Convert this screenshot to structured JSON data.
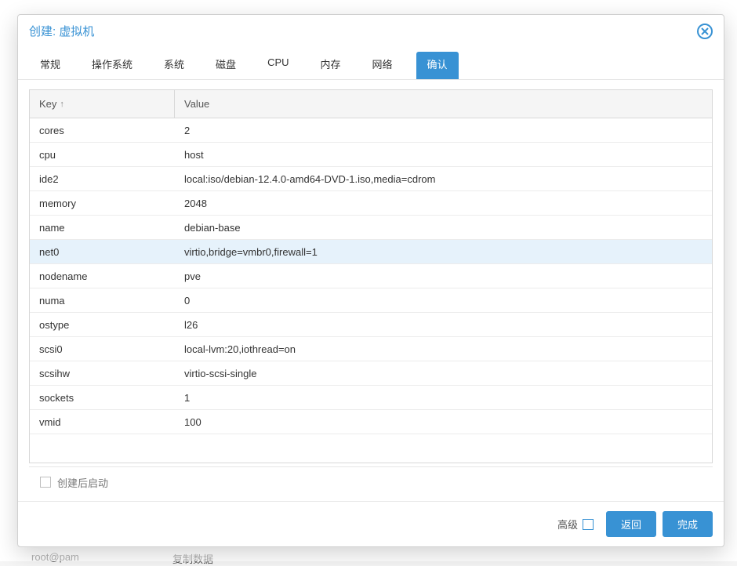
{
  "backdrop": {
    "text1": "root@pam",
    "text2": "复制数据"
  },
  "dialog": {
    "title": "创建: 虚拟机"
  },
  "tabs": [
    {
      "label": "常规"
    },
    {
      "label": "操作系统"
    },
    {
      "label": "系统"
    },
    {
      "label": "磁盘"
    },
    {
      "label": "CPU"
    },
    {
      "label": "内存"
    },
    {
      "label": "网络"
    },
    {
      "label": "确认",
      "active": true
    }
  ],
  "grid": {
    "keyHeader": "Key",
    "valueHeader": "Value",
    "sortArrow": "↑",
    "rows": [
      {
        "key": "cores",
        "value": "2"
      },
      {
        "key": "cpu",
        "value": "host"
      },
      {
        "key": "ide2",
        "value": "local:iso/debian-12.4.0-amd64-DVD-1.iso,media=cdrom"
      },
      {
        "key": "memory",
        "value": "2048"
      },
      {
        "key": "name",
        "value": "debian-base"
      },
      {
        "key": "net0",
        "value": "virtio,bridge=vmbr0,firewall=1",
        "hovered": true
      },
      {
        "key": "nodename",
        "value": "pve"
      },
      {
        "key": "numa",
        "value": "0"
      },
      {
        "key": "ostype",
        "value": "l26"
      },
      {
        "key": "scsi0",
        "value": "local-lvm:20,iothread=on"
      },
      {
        "key": "scsihw",
        "value": "virtio-scsi-single"
      },
      {
        "key": "sockets",
        "value": "1"
      },
      {
        "key": "vmid",
        "value": "100"
      }
    ]
  },
  "checkbox": {
    "label": "创建后启动"
  },
  "footer": {
    "advanced": "高级",
    "back": "返回",
    "finish": "完成"
  }
}
